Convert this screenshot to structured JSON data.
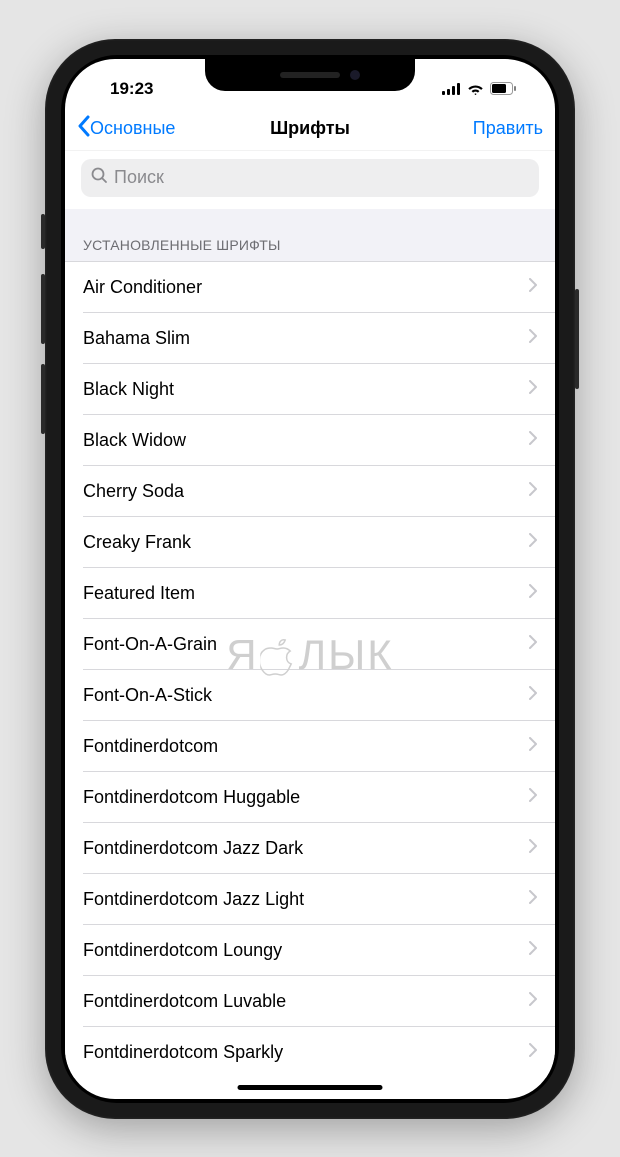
{
  "status_bar": {
    "time": "19:23"
  },
  "nav": {
    "back_label": "Основные",
    "title": "Шрифты",
    "edit_label": "Править"
  },
  "search": {
    "placeholder": "Поиск"
  },
  "section": {
    "header": "УСТАНОВЛЕННЫЕ ШРИФТЫ"
  },
  "fonts": [
    "Air Conditioner",
    "Bahama Slim",
    "Black Night",
    "Black Widow",
    "Cherry Soda",
    "Creaky Frank",
    "Featured Item",
    "Font-On-A-Grain",
    "Font-On-A-Stick",
    "Fontdinerdotcom",
    "Fontdinerdotcom Huggable",
    "Fontdinerdotcom Jazz Dark",
    "Fontdinerdotcom Jazz Light",
    "Fontdinerdotcom Loungy",
    "Fontdinerdotcom Luvable",
    "Fontdinerdotcom Sparkly"
  ],
  "watermark": {
    "text_before": "Я",
    "text_after": "ЛЫК"
  }
}
